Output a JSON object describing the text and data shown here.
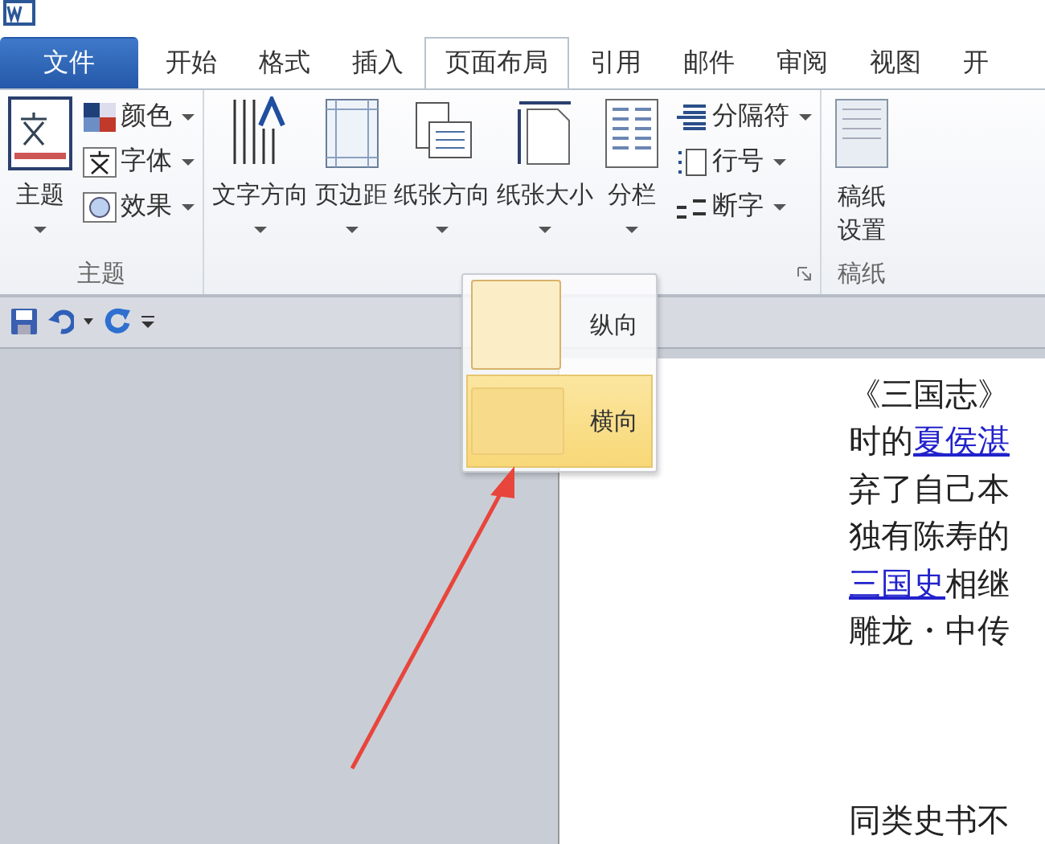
{
  "tabs": [
    {
      "label": "文件",
      "kind": "file",
      "selected": false
    },
    {
      "label": "开始",
      "kind": "tab",
      "selected": false
    },
    {
      "label": "格式",
      "kind": "tab",
      "selected": false
    },
    {
      "label": "插入",
      "kind": "tab",
      "selected": false
    },
    {
      "label": "页面布局",
      "kind": "tab",
      "selected": true
    },
    {
      "label": "引用",
      "kind": "tab",
      "selected": false
    },
    {
      "label": "邮件",
      "kind": "tab",
      "selected": false
    },
    {
      "label": "审阅",
      "kind": "tab",
      "selected": false
    },
    {
      "label": "视图",
      "kind": "tab",
      "selected": false
    },
    {
      "label": "开",
      "kind": "tab",
      "selected": false
    }
  ],
  "ribbon": {
    "groups": [
      {
        "label": "主题",
        "launcher": false,
        "large": [
          {
            "label": "主题",
            "menu": true
          }
        ],
        "small": [
          {
            "label": "颜色",
            "menu": true
          },
          {
            "label": "字体",
            "menu": true
          },
          {
            "label": "效果",
            "menu": true
          }
        ]
      },
      {
        "launcher": true,
        "large": [
          {
            "label": "文字方向",
            "menu": true
          },
          {
            "label": "页边距",
            "menu": true
          },
          {
            "label": "纸张方向",
            "menu": true
          },
          {
            "label": "纸张大小",
            "menu": true
          },
          {
            "label": "分栏",
            "menu": true
          }
        ],
        "small": [
          {
            "label": "分隔符",
            "menu": true
          },
          {
            "label": "行号",
            "menu": true
          },
          {
            "label": "断字",
            "menu": true
          }
        ]
      },
      {
        "label": "稿纸",
        "launcher": false,
        "large": [
          {
            "label": "稿纸设置",
            "menu": false
          }
        ]
      }
    ]
  },
  "orientation_menu": {
    "items": [
      {
        "label": "纵向",
        "selected": false
      },
      {
        "label": "横向",
        "selected": true
      }
    ]
  },
  "document": {
    "lines": [
      [
        {
          "text": "《三国志》",
          "link": false
        }
      ],
      [
        {
          "text": "时的",
          "link": false
        },
        {
          "text": "夏侯湛",
          "link": true
        }
      ],
      [
        {
          "text": "弃了自己本",
          "link": false
        }
      ],
      [
        {
          "text": "独有陈寿的",
          "link": false
        }
      ],
      [
        {
          "text": "三国史",
          "link": true
        },
        {
          "text": "相继",
          "link": false
        }
      ],
      [
        {
          "text": "雕龙・中传",
          "link": false
        }
      ]
    ],
    "last_line": "同类史书不"
  }
}
